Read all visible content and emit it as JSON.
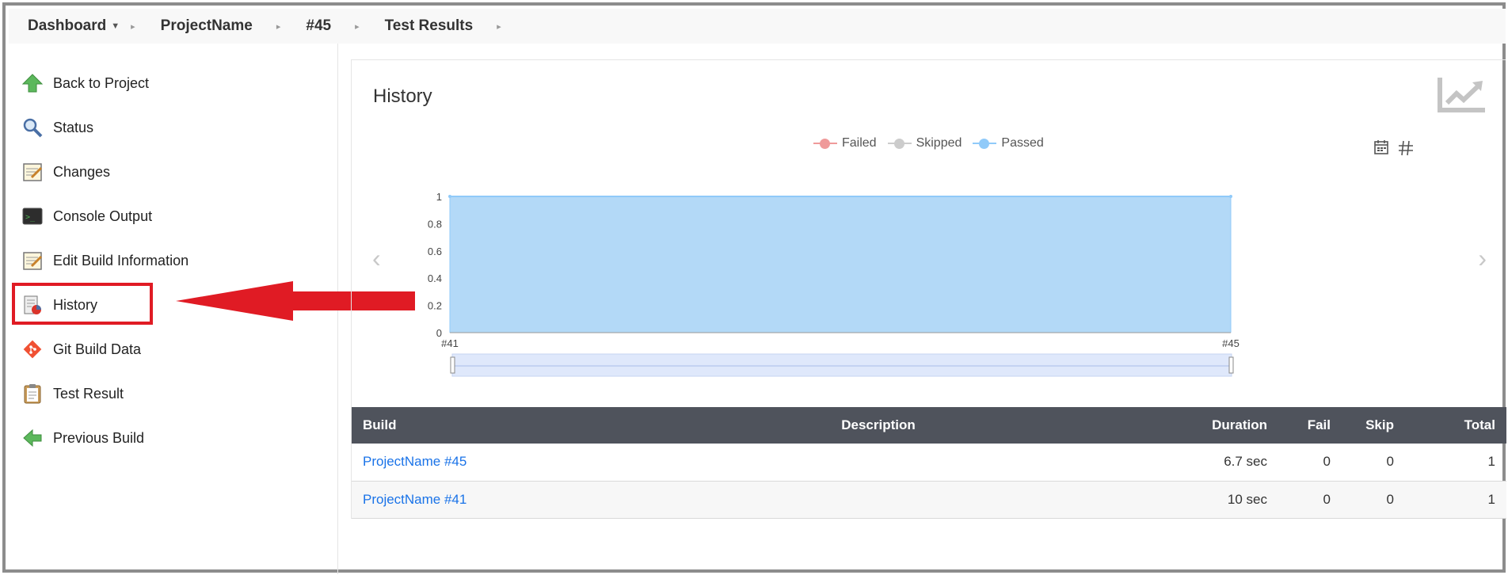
{
  "breadcrumb": {
    "dashboard": "Dashboard",
    "project": "ProjectName",
    "build": "#45",
    "page": "Test Results"
  },
  "sidebar": {
    "items": [
      {
        "label": "Back to Project",
        "icon": "up-arrow-icon"
      },
      {
        "label": "Status",
        "icon": "magnifier-icon"
      },
      {
        "label": "Changes",
        "icon": "notepad-icon"
      },
      {
        "label": "Console Output",
        "icon": "terminal-icon"
      },
      {
        "label": "Edit Build Information",
        "icon": "notepad-icon"
      },
      {
        "label": "History",
        "icon": "history-icon"
      },
      {
        "label": "Git Build Data",
        "icon": "git-icon"
      },
      {
        "label": "Test Result",
        "icon": "clipboard-icon"
      },
      {
        "label": "Previous Build",
        "icon": "left-arrow-icon"
      }
    ]
  },
  "panel": {
    "title": "History"
  },
  "legend": {
    "failed": "Failed",
    "skipped": "Skipped",
    "passed": "Passed"
  },
  "colors": {
    "failed": "#ef9a9a",
    "skipped": "#cccccc",
    "passed": "#90caf9",
    "area_fill": "#b3d9f7",
    "highlight": "#e01b24"
  },
  "chart_data": {
    "type": "area",
    "categories": [
      "#41",
      "#45"
    ],
    "series": [
      {
        "name": "Failed",
        "values": [
          0,
          0
        ]
      },
      {
        "name": "Skipped",
        "values": [
          0,
          0
        ]
      },
      {
        "name": "Passed",
        "values": [
          1,
          1
        ]
      }
    ],
    "yticks": [
      "0",
      "0.2",
      "0.4",
      "0.6",
      "0.8",
      "1"
    ],
    "ylim": [
      0,
      1
    ],
    "grid": true,
    "legend": "top-center"
  },
  "table": {
    "headers": {
      "build": "Build",
      "description": "Description",
      "duration": "Duration",
      "fail": "Fail",
      "skip": "Skip",
      "total": "Total"
    },
    "rows": [
      {
        "build": "ProjectName #45",
        "description": "",
        "duration": "6.7 sec",
        "fail": "0",
        "skip": "0",
        "total": "1"
      },
      {
        "build": "ProjectName #41",
        "description": "",
        "duration": "10 sec",
        "fail": "0",
        "skip": "0",
        "total": "1"
      }
    ]
  }
}
